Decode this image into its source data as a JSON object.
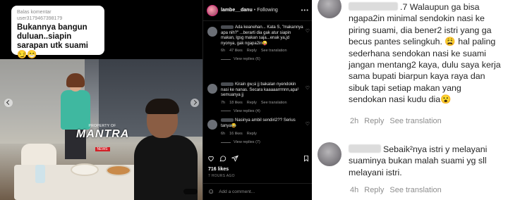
{
  "video": {
    "overlay": {
      "reply_to": "Balas komentar",
      "user": "user3179467398179",
      "message": "Bukannya bangun duluan..siapin sarapan utk suami 😏😁"
    },
    "watermark": {
      "top": "PROPERTY OF",
      "brand": "MANTRA",
      "badge": "NEWS"
    }
  },
  "instagram": {
    "username": "lambe__danu",
    "separator": "•",
    "follow_status": "Following",
    "more": "•••",
    "comments": [
      {
        "text": "Ada keanehan... Kata S, \"makannya apa nih?\" ...berarti dia gak atur siapin makan, lgsg makan saja...enak ya,jd nyonya, gak ngapa2in😜",
        "time": "6h",
        "likes": "47 likes",
        "reply": "Reply",
        "translate": "See translation",
        "replies": "View replies (6)"
      },
      {
        "text": "Kirain gw,si jj bakalan nyendokin nasi ke nanas. Secara kaaaaarrrnnn,apa² semuanya jj",
        "time": "7h",
        "likes": "18 likes",
        "reply": "Reply",
        "translate": "See translation",
        "replies": "View replies (4)"
      },
      {
        "text": "Nasinya ambil sendiri2?? Serius tanya😂",
        "time": "6h",
        "likes": "16 likes",
        "reply": "Reply",
        "translate": "",
        "replies": "View replies (7)"
      }
    ],
    "likes_total": "716 likes",
    "time_ago": "7 HOURS AGO",
    "add_comment_placeholder": "Add a comment..."
  },
  "detail": {
    "comments": [
      {
        "name_suffix": ".7",
        "text": "Walaupun ga bisa ngapa2in minimal sendokin nasi ke piring suami, dia bener2 istri yang ga becus pantes selingkuh. 😩 hal paling sederhana sendokan nasi ke suami jangan mentang2 kaya, dulu saya kerja sama bupati biarpun kaya raya dan sibuk tapi setiap makan yang sendokan nasi kudu dia😮",
        "time": "2h",
        "reply": "Reply",
        "translate": "See translation"
      },
      {
        "name_suffix": "",
        "text": "Sebaik²nya istri y melayani suaminya bukan malah suami yg sll melayani istri.",
        "time": "4h",
        "reply": "Reply",
        "translate": "See translation"
      }
    ]
  }
}
